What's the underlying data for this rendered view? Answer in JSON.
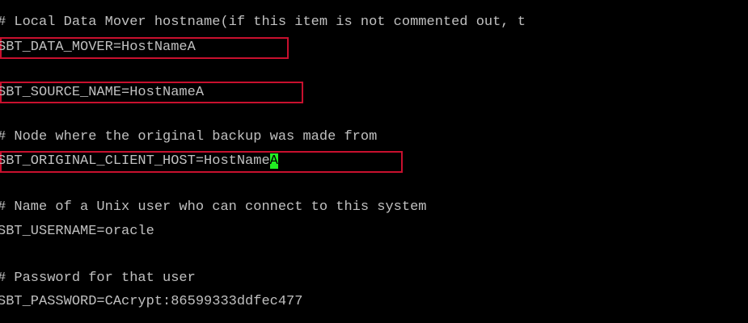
{
  "terminal": {
    "lines": [
      "# Local Data Mover hostname(if this item is not commented out, t",
      "SBT_DATA_MOVER=HostNameA",
      "",
      "SBT_SOURCE_NAME=HostNameA",
      "",
      "# Node where the original backup was made from",
      "SBT_ORIGINAL_CLIENT_HOST=HostName",
      "",
      "# Name of a Unix user who can connect to this system",
      "SBT_USERNAME=oracle",
      "",
      "# Password for that user",
      "SBT_PASSWORD=CAcrypt:86599333ddfec477"
    ],
    "cursor_char": "A"
  },
  "colors": {
    "background": "#000000",
    "text": "#c0c0c0",
    "highlight_border": "#c8102e",
    "cursor": "#22ee22"
  }
}
